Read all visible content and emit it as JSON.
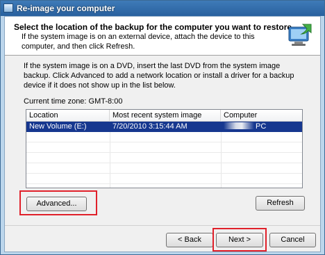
{
  "window": {
    "title": "Re-image your computer",
    "icon": "backup-restore-icon"
  },
  "header": {
    "title": "Select the location of the backup for the computer you want to restore",
    "subtitle": "If the system image is on an external device, attach the device to this computer, and then click Refresh.",
    "graphic": "computer-restore-icon"
  },
  "description": "If the system image is on a DVD, insert the last DVD from the system image backup. Click Advanced to add a network location or install a driver for a backup device if it does not show up in the list below.",
  "timezone": "Current time zone: GMT-8:00",
  "list": {
    "columns": [
      "Location",
      "Most recent system image",
      "Computer"
    ],
    "rows": [
      {
        "location": "New Volume (E:)",
        "image": "7/20/2010 3:15:44 AM",
        "computer": "PC",
        "selected": true
      }
    ]
  },
  "buttons": {
    "advanced": "Advanced...",
    "refresh": "Refresh",
    "back": "< Back",
    "next": "Next >",
    "cancel": "Cancel"
  },
  "colors": {
    "selection": "#16378f",
    "highlight": "#e0202a",
    "titlebar": "#3f7bb8"
  }
}
